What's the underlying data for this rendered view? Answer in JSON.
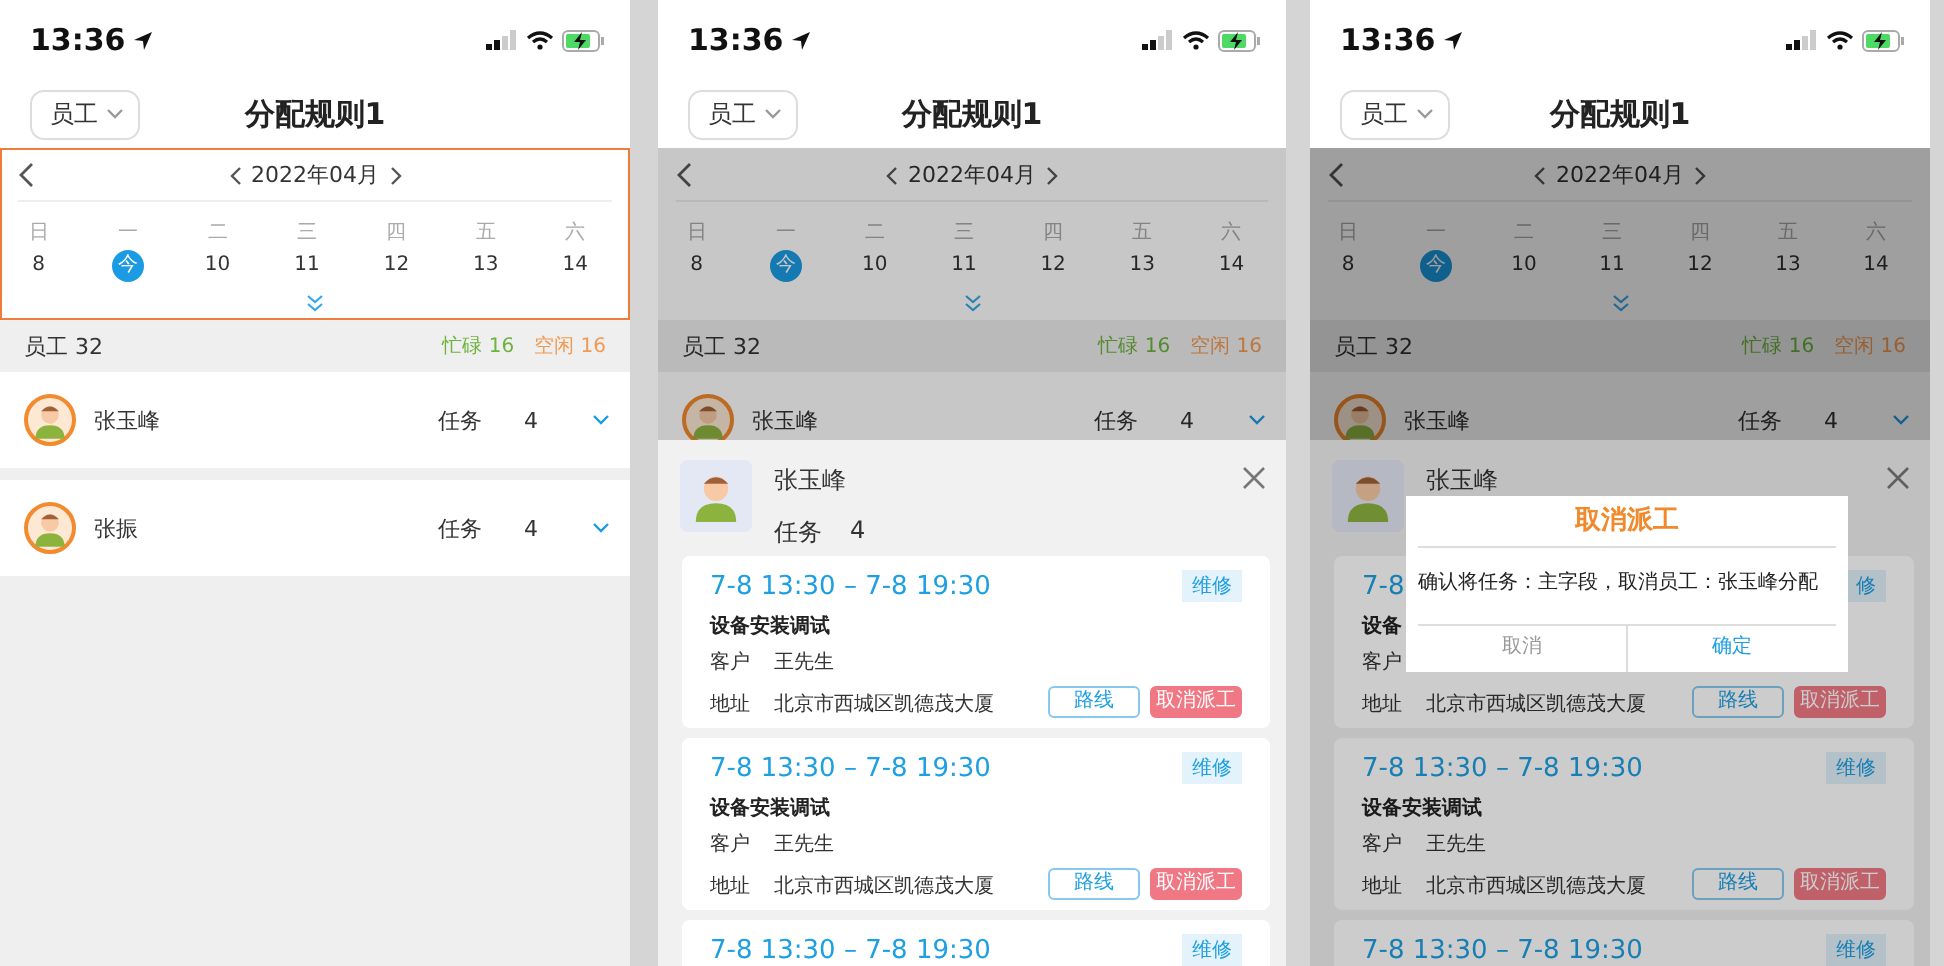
{
  "screens": [
    {
      "status_bar": {
        "time": "13:36"
      },
      "header": {
        "filter": "员工",
        "title": "分配规则1"
      },
      "calendar": {
        "focused": true,
        "month": "2022年04月",
        "weekdays": [
          "日",
          "一",
          "二",
          "三",
          "四",
          "五",
          "六"
        ],
        "days": [
          {
            "label": "8",
            "selected": false
          },
          {
            "label": "今",
            "selected": true
          },
          {
            "label": "10",
            "selected": false
          },
          {
            "label": "11",
            "selected": false
          },
          {
            "label": "12",
            "selected": false
          },
          {
            "label": "13",
            "selected": false
          },
          {
            "label": "14",
            "selected": false
          }
        ]
      },
      "summary": {
        "label": "员工 32",
        "busy": "忙碌 16",
        "free": "空闲 16"
      },
      "employees": [
        {
          "name": "张玉峰",
          "tasks_label": "任务",
          "tasks": "4"
        },
        {
          "name": "张振",
          "tasks_label": "任务",
          "tasks": "4"
        }
      ]
    },
    {
      "status_bar": {
        "time": "13:36"
      },
      "header": {
        "filter": "员工",
        "title": "分配规则1"
      },
      "calendar": {
        "focused": false,
        "month": "2022年04月",
        "weekdays": [
          "日",
          "一",
          "二",
          "三",
          "四",
          "五",
          "六"
        ],
        "days": [
          {
            "label": "8",
            "selected": false
          },
          {
            "label": "今",
            "selected": true
          },
          {
            "label": "10",
            "selected": false
          },
          {
            "label": "11",
            "selected": false
          },
          {
            "label": "12",
            "selected": false
          },
          {
            "label": "13",
            "selected": false
          },
          {
            "label": "14",
            "selected": false
          }
        ]
      },
      "summary": {
        "label": "员工 32",
        "busy": "忙碌 16",
        "free": "空闲 16"
      },
      "employees": [
        {
          "name": "张玉峰",
          "tasks_label": "任务",
          "tasks": "4"
        }
      ],
      "sheet": {
        "name": "张玉峰",
        "tasks_label": "任务",
        "tasks": "4",
        "cards": [
          {
            "time": "7-8 13:30 – 7-8 19:30",
            "tag": "维修",
            "title": "设备安装调试",
            "customer_label": "客户",
            "customer": "王先生",
            "address_label": "地址",
            "address": "北京市西城区凯德茂大厦",
            "route": "路线",
            "cancel": "取消派工"
          },
          {
            "time": "7-8 13:30 – 7-8 19:30",
            "tag": "维修",
            "title": "设备安装调试",
            "customer_label": "客户",
            "customer": "王先生",
            "address_label": "地址",
            "address": "北京市西城区凯德茂大厦",
            "route": "路线",
            "cancel": "取消派工"
          },
          {
            "time": "7-8 13:30 – 7-8 19:30",
            "tag": "维修"
          }
        ]
      }
    },
    {
      "status_bar": {
        "time": "13:36"
      },
      "header": {
        "filter": "员工",
        "title": "分配规则1"
      },
      "calendar": {
        "focused": false,
        "month": "2022年04月",
        "weekdays": [
          "日",
          "一",
          "二",
          "三",
          "四",
          "五",
          "六"
        ],
        "days": [
          {
            "label": "8",
            "selected": false
          },
          {
            "label": "今",
            "selected": true
          },
          {
            "label": "10",
            "selected": false
          },
          {
            "label": "11",
            "selected": false
          },
          {
            "label": "12",
            "selected": false
          },
          {
            "label": "13",
            "selected": false
          },
          {
            "label": "14",
            "selected": false
          }
        ]
      },
      "summary": {
        "label": "员工 32",
        "busy": "忙碌 16",
        "free": "空闲 16"
      },
      "employees": [
        {
          "name": "张玉峰",
          "tasks_label": "任务",
          "tasks": "4"
        }
      ],
      "sheet": {
        "name": "张玉峰",
        "cards": [
          {
            "time": "7-8",
            "tag": "修",
            "title": "设备",
            "customer_label": "客户",
            "address_label": "地址",
            "address": "北京市西城区凯德茂大厦",
            "route": "路线",
            "cancel": "取消派工"
          },
          {
            "time": "7-8 13:30 – 7-8 19:30",
            "tag": "维修",
            "title": "设备安装调试",
            "customer_label": "客户",
            "customer": "王先生",
            "address_label": "地址",
            "address": "北京市西城区凯德茂大厦",
            "route": "路线",
            "cancel": "取消派工"
          },
          {
            "time": "7-8 13:30 – 7-8 19:30",
            "tag": "维修"
          }
        ]
      },
      "dialog": {
        "title": "取消派工",
        "message": "确认将任务：主字段，取消员工：张玉峰分配",
        "cancel": "取消",
        "confirm": "确定"
      }
    }
  ]
}
